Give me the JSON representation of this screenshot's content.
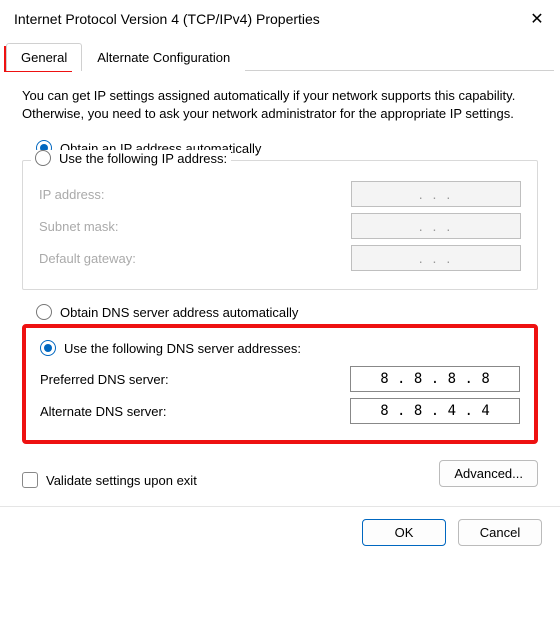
{
  "window": {
    "title": "Internet Protocol Version 4 (TCP/IPv4) Properties",
    "close_icon": "✕"
  },
  "tabs": {
    "general": "General",
    "alternate": "Alternate Configuration"
  },
  "description": "You can get IP settings assigned automatically if your network supports this capability. Otherwise, you need to ask your network administrator for the appropriate IP settings.",
  "ip": {
    "auto_label": "Obtain an IP address automatically",
    "manual_label": "Use the following IP address:",
    "auto_selected": true,
    "fields": {
      "address_label": "IP address:",
      "subnet_label": "Subnet mask:",
      "gateway_label": "Default gateway:",
      "address_value": "",
      "subnet_value": "",
      "gateway_value": ""
    }
  },
  "dns": {
    "auto_label": "Obtain DNS server address automatically",
    "manual_label": "Use the following DNS server addresses:",
    "manual_selected": true,
    "fields": {
      "preferred_label": "Preferred DNS server:",
      "alternate_label": "Alternate DNS server:",
      "preferred_value": "8 . 8 . 8 . 8",
      "alternate_value": "8 . 8 . 4 . 4"
    }
  },
  "validate": {
    "label": "Validate settings upon exit",
    "checked": false
  },
  "buttons": {
    "advanced": "Advanced...",
    "ok": "OK",
    "cancel": "Cancel"
  },
  "disabled_ip_placeholder": ".       .       ."
}
